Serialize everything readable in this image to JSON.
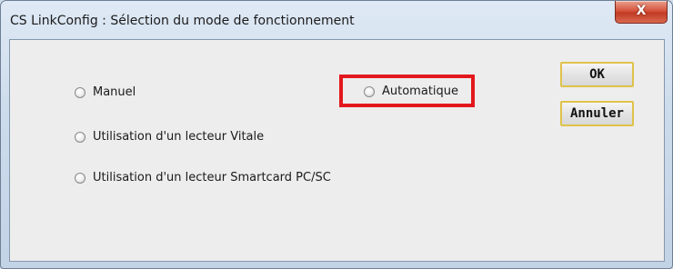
{
  "window": {
    "title": "CS LinkConfig : Sélection du mode de fonctionnement",
    "close_label": "X"
  },
  "options": {
    "manuel": "Manuel",
    "automatique": "Automatique",
    "vitale": "Utilisation d'un lecteur Vitale",
    "smartcard": "Utilisation d'un lecteur Smartcard PC/SC"
  },
  "buttons": {
    "ok": "OK",
    "cancel": "Annuler"
  },
  "colors": {
    "highlight": "#e3181d",
    "default_button_border": "#e0c24a"
  }
}
